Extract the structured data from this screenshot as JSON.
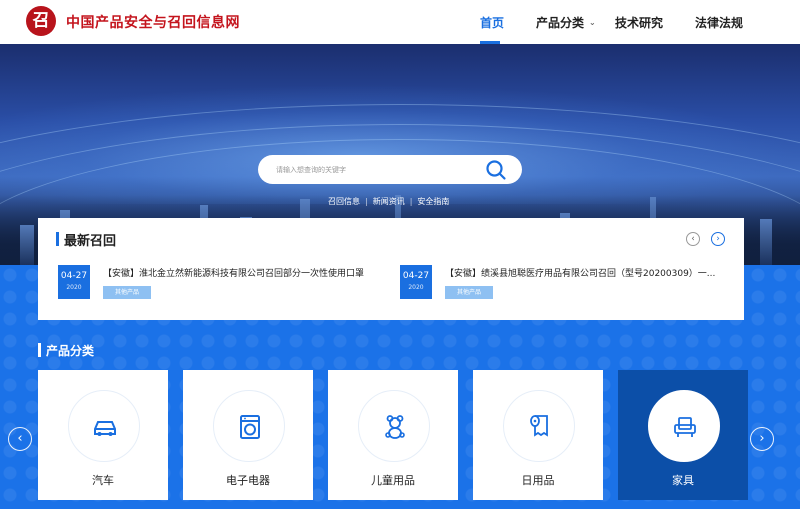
{
  "header": {
    "logo_char": "召",
    "site_title": "中国产品安全与召回信息网",
    "nav": [
      {
        "label": "首页",
        "active": true
      },
      {
        "label": "产品分类",
        "has_dropdown": true
      },
      {
        "label": "技术研究"
      },
      {
        "label": "法律法规"
      }
    ]
  },
  "hero": {
    "search_placeholder": "请输入想查询的关键字",
    "quick_links": [
      "召回信息",
      "新闻资讯",
      "安全指南"
    ]
  },
  "recall": {
    "title": "最新召回",
    "items": [
      {
        "day": "04-27",
        "year": "2020",
        "text": "【安徽】淮北金立然新能源科技有限公司召回部分一次性使用口罩",
        "tag": "其他产品"
      },
      {
        "day": "04-27",
        "year": "2020",
        "text": "【安徽】绩溪县旭聪医疗用品有限公司召回（型号20200309）一...",
        "tag": "其他产品"
      }
    ]
  },
  "categories": {
    "title": "产品分类",
    "items": [
      {
        "label": "汽车",
        "icon": "car-icon"
      },
      {
        "label": "电子电器",
        "icon": "washing-machine-icon"
      },
      {
        "label": "儿童用品",
        "icon": "teddy-bear-icon"
      },
      {
        "label": "日用品",
        "icon": "tissue-roll-icon"
      },
      {
        "label": "家具",
        "icon": "armchair-icon",
        "active": true
      }
    ]
  },
  "colors": {
    "brand_red": "#c4141d",
    "accent_blue": "#1a6fe0",
    "active_card": "#0c4fa8"
  }
}
